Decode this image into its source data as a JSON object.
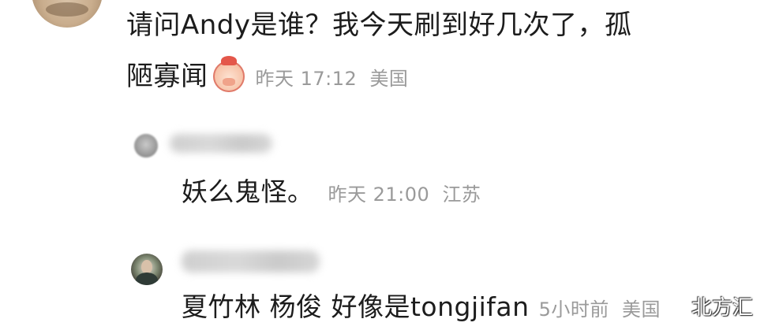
{
  "comment": {
    "line1": "请问Andy是谁？我今天刷到好几次了，孤",
    "line2": "陋寡闻",
    "emoji_icon": "praying-face-emoji",
    "time": "昨天 17:12",
    "location": "美国"
  },
  "reply1": {
    "text": "妖么鬼怪。",
    "time": "昨天 21:00",
    "location": "江苏"
  },
  "reply2": {
    "text": "夏竹林 杨俊 好像是tongjifan",
    "time": "5小时前",
    "location": "美国"
  },
  "watermark": "北方汇"
}
